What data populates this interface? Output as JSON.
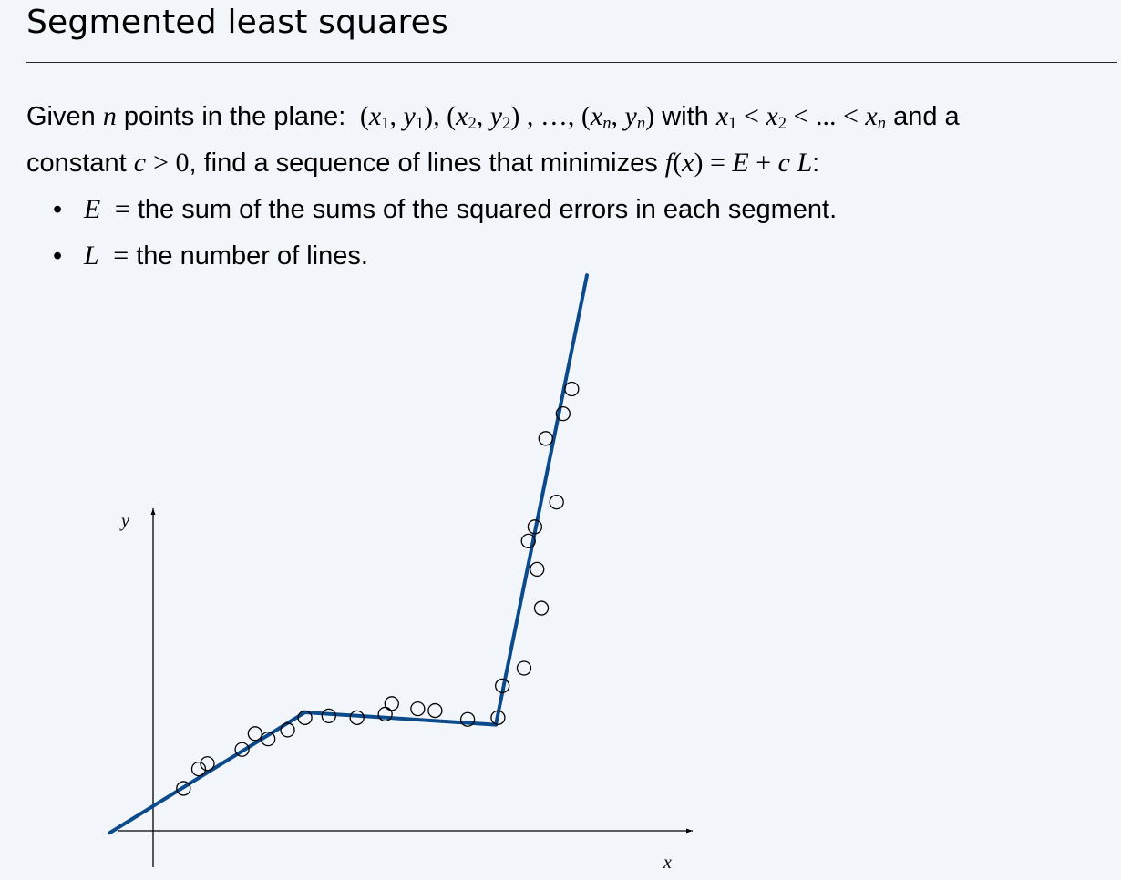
{
  "title": "Segmented least squares",
  "intro": {
    "line1": {
      "given": "Given",
      "n": "n",
      "points_in_plane": "points in the plane:",
      "x1": "x",
      "x1_sub": "1",
      "y1": "y",
      "y1_sub": "1",
      "x2": "x",
      "x2_sub": "2",
      "y2": "y",
      "y2_sub": "2",
      "ellipsis": "…",
      "xn": "x",
      "xn_sub": "n",
      "yn": "y",
      "yn_sub": "n",
      "with": "with",
      "order_x1": "x",
      "order_x1_sub": "1",
      "order_x2": "x",
      "order_x2_sub": "2",
      "order_dots": "...",
      "order_xn": "x",
      "order_xn_sub": "n",
      "and_a": "and a"
    },
    "line2": {
      "constant": "constant",
      "c": "c",
      "gt_zero": "> 0",
      "find_text": ", find a sequence of lines that minimizes",
      "f": "f",
      "fx_arg": "x",
      "eq_E": "E",
      "plus": "+",
      "c2": "c",
      "L": "L",
      "colon": ":"
    }
  },
  "bullets": [
    {
      "symbol": "E",
      "text": "the sum of the sums of the squared errors in each segment."
    },
    {
      "symbol": "L",
      "text": "the number of lines."
    }
  ],
  "diagram": {
    "y_axis_label": "y",
    "x_axis_label": "x",
    "line_color": "#0b4a8b",
    "point_stroke": "#000000",
    "segments": [
      {
        "from": [
          0,
          0.7
        ],
        "to": [
          3.5,
          3.35
        ]
      },
      {
        "from": [
          3.5,
          3.35
        ],
        "to": [
          7.9,
          3.0
        ]
      },
      {
        "from": [
          7.9,
          3.0
        ],
        "to": [
          9.7,
          13.9
        ]
      }
    ],
    "points": [
      [
        0.7,
        1.2
      ],
      [
        1.05,
        1.75
      ],
      [
        1.25,
        1.9
      ],
      [
        2.05,
        2.3
      ],
      [
        2.35,
        2.75
      ],
      [
        2.65,
        2.6
      ],
      [
        3.1,
        2.85
      ],
      [
        3.5,
        3.2
      ],
      [
        4.05,
        3.25
      ],
      [
        4.7,
        3.2
      ],
      [
        5.35,
        3.3
      ],
      [
        5.5,
        3.6
      ],
      [
        6.1,
        3.45
      ],
      [
        6.5,
        3.4
      ],
      [
        7.25,
        3.15
      ],
      [
        7.95,
        3.2
      ],
      [
        8.05,
        4.1
      ],
      [
        8.55,
        4.6
      ],
      [
        8.65,
        8.2
      ],
      [
        8.8,
        8.6
      ],
      [
        8.85,
        7.4
      ],
      [
        8.95,
        6.3
      ],
      [
        9.05,
        11.1
      ],
      [
        9.3,
        9.3
      ],
      [
        9.45,
        11.8
      ],
      [
        9.65,
        12.5
      ]
    ]
  }
}
